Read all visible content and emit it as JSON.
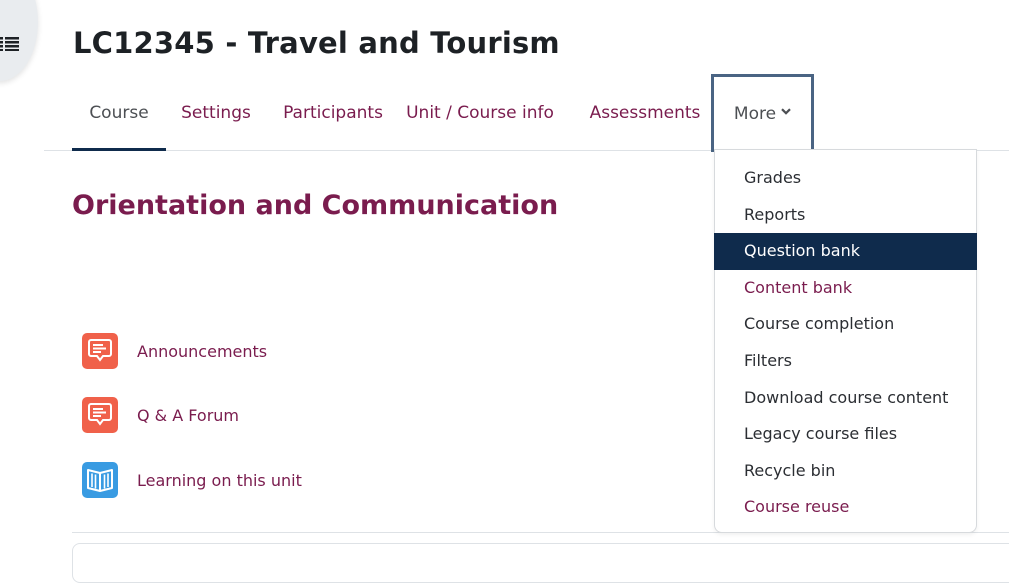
{
  "header": {
    "course_title": "LC12345 - Travel and Tourism",
    "drawer_toggle_icon": "list-icon"
  },
  "nav": {
    "tabs": [
      {
        "label": "Course",
        "active": true
      },
      {
        "label": "Settings"
      },
      {
        "label": "Participants"
      },
      {
        "label": "Unit / Course info"
      },
      {
        "label": "Assessments"
      },
      {
        "label": "More",
        "icon": "chevron-down-icon",
        "expanded": true
      }
    ]
  },
  "more_menu": {
    "items": [
      {
        "label": "Grades"
      },
      {
        "label": "Reports"
      },
      {
        "label": "Question bank",
        "highlighted": true
      },
      {
        "label": "Content bank",
        "style": "link"
      },
      {
        "label": "Course completion"
      },
      {
        "label": "Filters"
      },
      {
        "label": "Download course content"
      },
      {
        "label": "Legacy course files"
      },
      {
        "label": "Recycle bin"
      },
      {
        "label": "Course reuse",
        "style": "link"
      }
    ]
  },
  "section": {
    "title": "Orientation and Communication",
    "activities": [
      {
        "label": "Announcements",
        "icon": "forum-icon",
        "icon_color": "#f0614a"
      },
      {
        "label": "Q & A Forum",
        "icon": "forum-icon",
        "icon_color": "#f0614a"
      },
      {
        "label": "Learning on this unit",
        "icon": "book-icon",
        "icon_color": "#399be2"
      }
    ]
  },
  "colors": {
    "brand": "#7a1c4e",
    "active_underline": "#0f2b4c",
    "menu_highlight": "#0f2b4c",
    "focus_border": "#4a6483"
  }
}
